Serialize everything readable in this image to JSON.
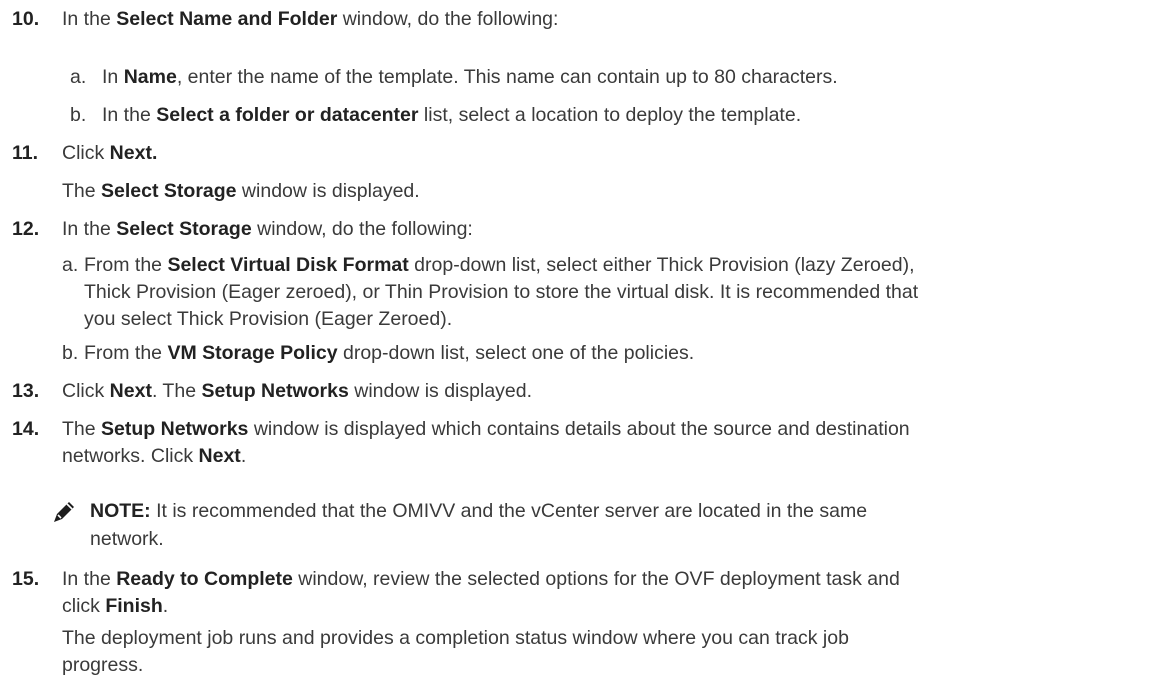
{
  "steps": [
    {
      "number": "10.",
      "parts": [
        "In the ",
        "Select Name and Folder",
        " window, do the following:"
      ],
      "substeps": [
        {
          "letter": "a.",
          "parts": [
            "In ",
            "Name",
            ", enter the name of the template. This name can contain up to 80 characters."
          ]
        },
        {
          "letter": "b.",
          "parts": [
            "In the ",
            "Select a folder or datacenter",
            " list, select a location to deploy the template."
          ]
        }
      ]
    },
    {
      "number": "11.",
      "parts": [
        "Click ",
        "Next."
      ],
      "detail": [
        "The ",
        "Select Storage",
        " window is displayed."
      ]
    },
    {
      "number": "12.",
      "parts": [
        "In the ",
        "Select Storage",
        " window, do the following:"
      ],
      "substeps": [
        {
          "letter": "a.",
          "lines": [
            [
              "From the ",
              "Select Virtual Disk Format",
              " drop-down list, select either Thick Provision (lazy Zeroed),"
            ],
            [
              "Thick Provision (Eager zeroed), or Thin Provision to store the virtual disk. It is recommended that"
            ],
            [
              "you select Thick Provision (Eager Zeroed)."
            ]
          ]
        },
        {
          "letter": "b.",
          "parts": [
            "From the ",
            "VM Storage Policy",
            " drop-down list, select one of the policies."
          ]
        }
      ]
    },
    {
      "number": "13.",
      "parts": [
        "Click ",
        "Next",
        ". The ",
        "Setup Networks",
        " window is displayed."
      ]
    },
    {
      "number": "14.",
      "lines": [
        [
          "The ",
          "Setup Networks",
          " window is displayed which contains details about the source and destination"
        ],
        [
          "networks. Click ",
          "Next",
          "."
        ]
      ],
      "note": {
        "icon": "pencil-note-icon",
        "label": "NOTE:",
        "lines": [
          " It is recommended that the OMIVV and the vCenter server are located in the same",
          "network."
        ]
      }
    },
    {
      "number": "15.",
      "lines": [
        [
          "In the ",
          "Ready to Complete",
          " window, review the selected options for the OVF deployment task and"
        ],
        [
          "click ",
          "Finish",
          "."
        ]
      ],
      "detail_lines": [
        "The deployment job runs and provides a completion status window where you can track job",
        "progress."
      ]
    }
  ]
}
